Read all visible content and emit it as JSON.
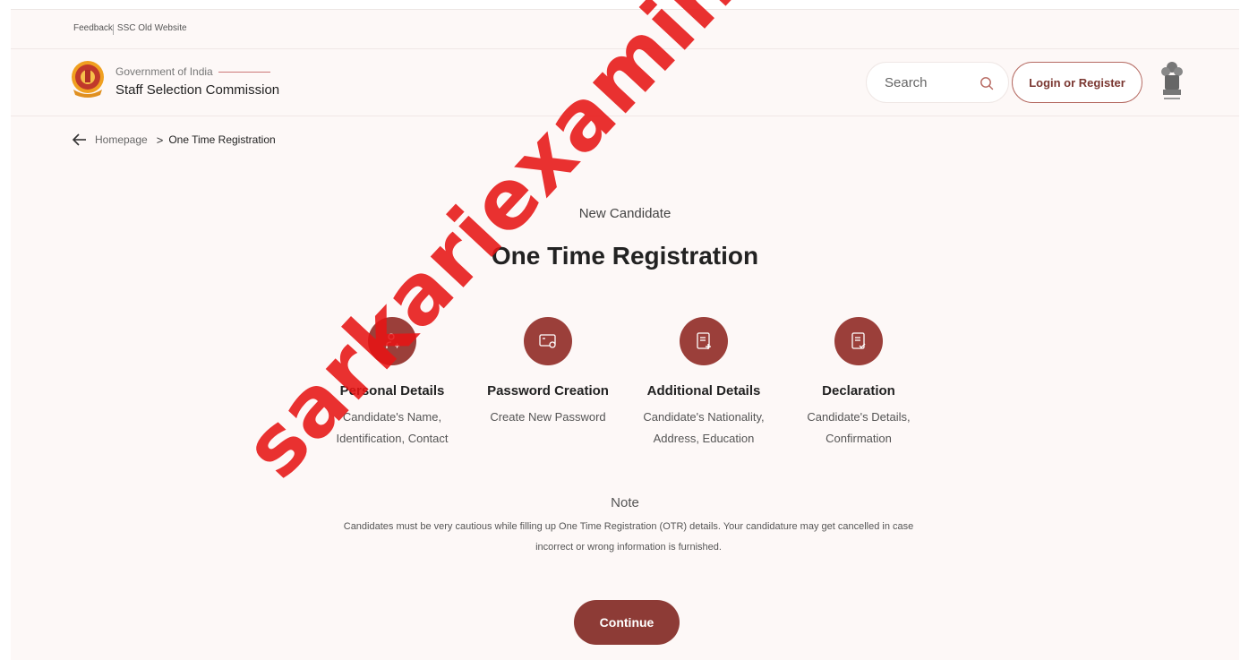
{
  "utility": {
    "feedback": "Feedback",
    "old_site": "SSC Old Website"
  },
  "header": {
    "gov_line": "Government of India",
    "org_name": "Staff Selection Commission",
    "search_placeholder": "Search",
    "login_label": "Login or Register"
  },
  "breadcrumb": {
    "home": "Homepage",
    "separator": ">",
    "current": "One Time Registration"
  },
  "main": {
    "subtitle": "New Candidate",
    "title": "One Time Registration"
  },
  "steps": [
    {
      "icon": "user-add-icon",
      "title": "Personal Details",
      "desc_line1": "Candidate's Name,",
      "desc_line2": "Identification, Contact"
    },
    {
      "icon": "password-icon",
      "title": "Password Creation",
      "desc_line1": "Create New Password",
      "desc_line2": ""
    },
    {
      "icon": "document-add-icon",
      "title": "Additional Details",
      "desc_line1": "Candidate's Nationality,",
      "desc_line2": "Address, Education"
    },
    {
      "icon": "document-check-icon",
      "title": "Declaration",
      "desc_line1": "Candidate's Details,",
      "desc_line2": "Confirmation"
    }
  ],
  "note": {
    "title": "Note",
    "text": "Candidates must be very cautious while filling up One Time Registration (OTR) details. Your candidature may get cancelled in case incorrect or wrong information is furnished."
  },
  "continue_label": "Continue",
  "watermark": "sarkariexamindassamjob.com",
  "colors": {
    "brand": "#9b3f3a",
    "button": "#8d3b36",
    "background": "#fdf8f7",
    "watermark": "#e61414"
  }
}
